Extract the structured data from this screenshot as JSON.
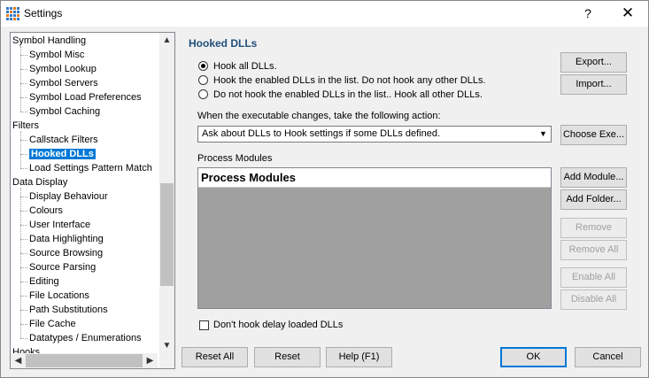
{
  "window": {
    "title": "Settings",
    "help": "?",
    "close": "✕"
  },
  "tree": {
    "items": [
      {
        "label": "Symbol Handling",
        "level": 0
      },
      {
        "label": "Symbol Misc",
        "level": 1
      },
      {
        "label": "Symbol Lookup",
        "level": 1
      },
      {
        "label": "Symbol Servers",
        "level": 1
      },
      {
        "label": "Symbol Load Preferences",
        "level": 1
      },
      {
        "label": "Symbol Caching",
        "level": 1
      },
      {
        "label": "Filters",
        "level": 0
      },
      {
        "label": "Callstack Filters",
        "level": 1
      },
      {
        "label": "Hooked DLLs",
        "level": 1,
        "selected": true
      },
      {
        "label": "Load Settings Pattern Match",
        "level": 1
      },
      {
        "label": "Data Display",
        "level": 0
      },
      {
        "label": "Display Behaviour",
        "level": 1
      },
      {
        "label": "Colours",
        "level": 1
      },
      {
        "label": "User Interface",
        "level": 1
      },
      {
        "label": "Data Highlighting",
        "level": 1
      },
      {
        "label": "Source Browsing",
        "level": 1
      },
      {
        "label": "Source Parsing",
        "level": 1
      },
      {
        "label": "Editing",
        "level": 1
      },
      {
        "label": "File Locations",
        "level": 1
      },
      {
        "label": "Path Substitutions",
        "level": 1
      },
      {
        "label": "File Cache",
        "level": 1
      },
      {
        "label": "Datatypes / Enumerations",
        "level": 1
      },
      {
        "label": "Hooks",
        "level": 0
      }
    ]
  },
  "panel": {
    "heading": "Hooked DLLs",
    "radios": [
      {
        "label": "Hook all DLLs.",
        "checked": true
      },
      {
        "label": "Hook the enabled DLLs in the list. Do not hook any other DLLs.",
        "checked": false
      },
      {
        "label": "Do not hook the enabled DLLs in the list.. Hook all other DLLs.",
        "checked": false
      }
    ],
    "exe_change_label": "When the executable changes, take the following action:",
    "exe_change_value": "Ask about DLLs to Hook settings if some DLLs defined.",
    "process_modules_label": "Process Modules",
    "list_header": "Process Modules",
    "delay_loaded_label": "Don't hook delay loaded DLLs",
    "delay_loaded_checked": false
  },
  "buttons": {
    "export": "Export...",
    "import": "Import...",
    "choose_exe": "Choose Exe...",
    "add_module": "Add Module...",
    "add_folder": "Add Folder...",
    "remove": "Remove",
    "remove_all": "Remove All",
    "enable_all": "Enable All",
    "disable_all": "Disable All",
    "reset_all": "Reset All",
    "reset": "Reset",
    "help": "Help (F1)",
    "ok": "OK",
    "cancel": "Cancel"
  }
}
